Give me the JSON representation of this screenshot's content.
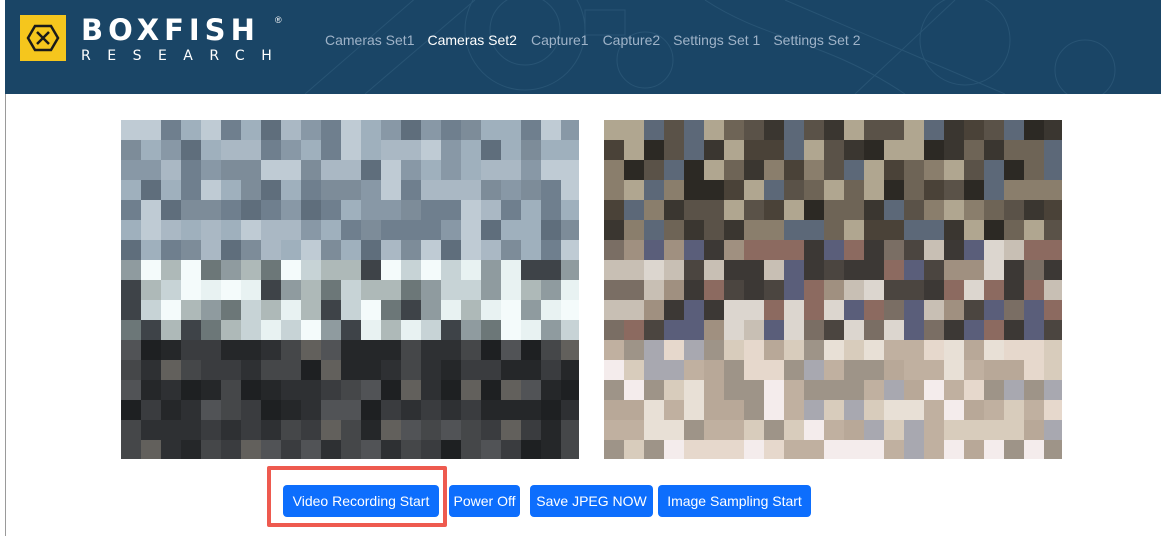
{
  "brand": {
    "name": "BOXFISH",
    "sub": "RESEARCH",
    "reg": "®",
    "accent": "#f5c61d",
    "header_bg": "#1a4566"
  },
  "nav": {
    "items": [
      {
        "label": "Cameras Set1",
        "active": false
      },
      {
        "label": "Cameras Set2",
        "active": true
      },
      {
        "label": "Capture1",
        "active": false
      },
      {
        "label": "Capture2",
        "active": false
      },
      {
        "label": "Settings Set 1",
        "active": false
      },
      {
        "label": "Settings Set 2",
        "active": false
      }
    ]
  },
  "cameras": [
    {
      "name": "camera-feed-1",
      "state": "pixelated"
    },
    {
      "name": "camera-feed-2",
      "state": "pixelated"
    }
  ],
  "buttons": {
    "video_recording": "Video Recording Start",
    "power_off": "Power Off",
    "save_jpeg": "Save JPEG NOW",
    "image_sampling": "Image Sampling Start",
    "color": "#0d6efd"
  },
  "annotation": {
    "highlight_color": "#ee5a4f",
    "target": "video-recording-start-button"
  }
}
